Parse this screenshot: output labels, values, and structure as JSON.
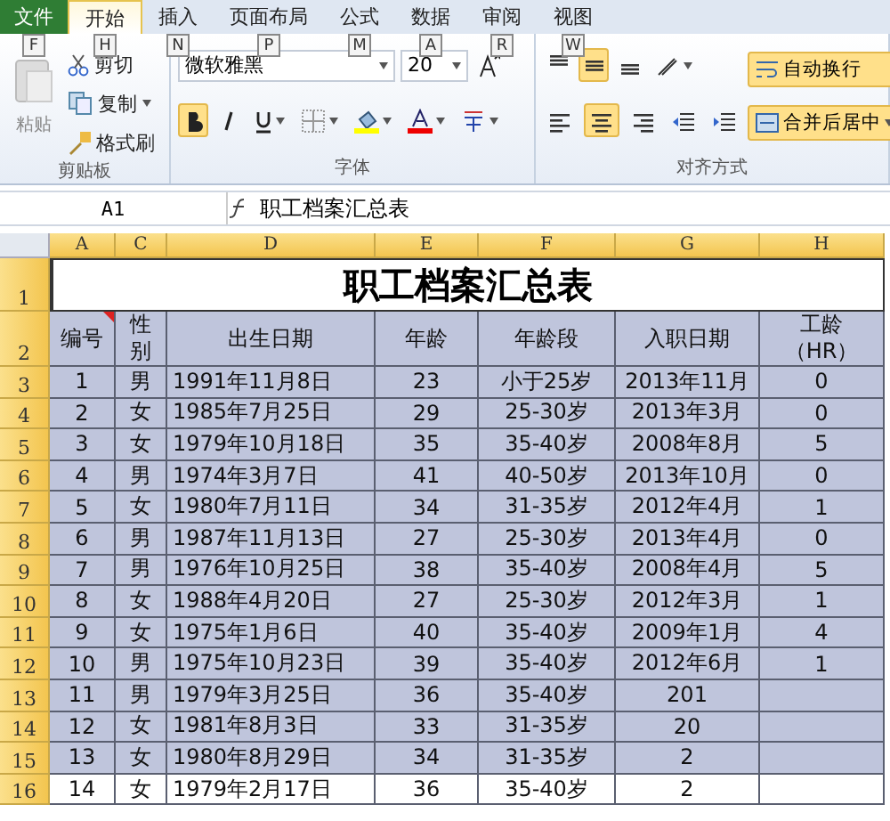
{
  "tabs": [
    {
      "label": "文件",
      "keytip": "F",
      "kind": "file",
      "selected": false
    },
    {
      "label": "开始",
      "keytip": "H",
      "kind": "tab",
      "selected": true
    },
    {
      "label": "插入",
      "keytip": "N",
      "kind": "tab",
      "selected": false
    },
    {
      "label": "页面布局",
      "keytip": "P",
      "kind": "tab",
      "selected": false
    },
    {
      "label": "公式",
      "keytip": "M",
      "kind": "tab",
      "selected": false
    },
    {
      "label": "数据",
      "keytip": "A",
      "kind": "tab",
      "selected": false
    },
    {
      "label": "审阅",
      "keytip": "R",
      "kind": "tab",
      "selected": false
    },
    {
      "label": "视图",
      "keytip": "W",
      "kind": "tab",
      "selected": false
    }
  ],
  "clipboard": {
    "label": "剪贴板",
    "paste": "粘贴",
    "cut": "剪切",
    "copy": "复制",
    "format_painter": "格式刷"
  },
  "font": {
    "label": "字体",
    "name": "微软雅黑",
    "size": "20",
    "bold": true,
    "italic": false,
    "underline": false
  },
  "alignment": {
    "label": "对齐方式",
    "vertical": [
      {
        "kind": "top",
        "selected": false
      },
      {
        "kind": "middle",
        "selected": true
      },
      {
        "kind": "bottom",
        "selected": false
      }
    ],
    "horizontal": [
      {
        "kind": "left",
        "selected": false
      },
      {
        "kind": "center",
        "selected": true
      },
      {
        "kind": "right",
        "selected": false
      }
    ],
    "wrap_text": {
      "label": "自动换行",
      "on": true
    },
    "merge_center": {
      "label": "合并后居中",
      "on": true
    }
  },
  "formula_bar": {
    "name_box": "A1",
    "content": "职工档案汇总表"
  },
  "sheet": {
    "columns": [
      "A",
      "C",
      "D",
      "E",
      "F",
      "G",
      "H"
    ],
    "title_row": {
      "number": "1",
      "title": "职工档案汇总表"
    },
    "header_row": {
      "number": "2",
      "headers": [
        {
          "lines": [
            "编号"
          ],
          "comment": true
        },
        {
          "lines": [
            "性",
            "别"
          ],
          "comment": false
        },
        {
          "lines": [
            "出生日期"
          ],
          "comment": false
        },
        {
          "lines": [
            "年龄"
          ],
          "comment": false
        },
        {
          "lines": [
            "年龄段"
          ],
          "comment": false
        },
        {
          "lines": [
            "入职日期"
          ],
          "comment": false
        },
        {
          "lines": [
            "工龄",
            "（HR）"
          ],
          "comment": false
        }
      ]
    },
    "rows": [
      {
        "number": "3",
        "filled": true,
        "cells": [
          "1",
          "男",
          "1991年11月8日",
          "23",
          "小于25岁",
          "2013年11月",
          "0"
        ]
      },
      {
        "number": "4",
        "filled": true,
        "cells": [
          "2",
          "女",
          "1985年7月25日",
          "29",
          "25-30岁",
          "2013年3月",
          "0"
        ]
      },
      {
        "number": "5",
        "filled": true,
        "cells": [
          "3",
          "女",
          "1979年10月18日",
          "35",
          "35-40岁",
          "2008年8月",
          "5"
        ]
      },
      {
        "number": "6",
        "filled": true,
        "cells": [
          "4",
          "男",
          "1974年3月7日",
          "41",
          "40-50岁",
          "2013年10月",
          "0"
        ]
      },
      {
        "number": "7",
        "filled": true,
        "cells": [
          "5",
          "女",
          "1980年7月11日",
          "34",
          "31-35岁",
          "2012年4月",
          "1"
        ]
      },
      {
        "number": "8",
        "filled": true,
        "cells": [
          "6",
          "男",
          "1987年11月13日",
          "27",
          "25-30岁",
          "2013年4月",
          "0"
        ]
      },
      {
        "number": "9",
        "filled": true,
        "cells": [
          "7",
          "男",
          "1976年10月25日",
          "38",
          "35-40岁",
          "2008年4月",
          "5"
        ]
      },
      {
        "number": "10",
        "filled": true,
        "cells": [
          "8",
          "女",
          "1988年4月20日",
          "27",
          "25-30岁",
          "2012年3月",
          "1"
        ]
      },
      {
        "number": "11",
        "filled": true,
        "cells": [
          "9",
          "女",
          "1975年1月6日",
          "40",
          "35-40岁",
          "2009年1月",
          "4"
        ]
      },
      {
        "number": "12",
        "filled": true,
        "cells": [
          "10",
          "男",
          "1975年10月23日",
          "39",
          "35-40岁",
          "2012年6月",
          "1"
        ]
      },
      {
        "number": "13",
        "filled": true,
        "cells": [
          "11",
          "男",
          "1979年3月25日",
          "36",
          "35-40岁",
          "201",
          ""
        ]
      },
      {
        "number": "14",
        "filled": true,
        "cells": [
          "12",
          "女",
          "1981年8月3日",
          "33",
          "31-35岁",
          "20",
          ""
        ]
      },
      {
        "number": "15",
        "filled": true,
        "cells": [
          "13",
          "女",
          "1980年8月29日",
          "34",
          "31-35岁",
          "2",
          ""
        ]
      },
      {
        "number": "16",
        "filled": false,
        "cells": [
          "14",
          "女",
          "1979年2月17日",
          "36",
          "35-40岁",
          "2",
          ""
        ]
      }
    ]
  }
}
